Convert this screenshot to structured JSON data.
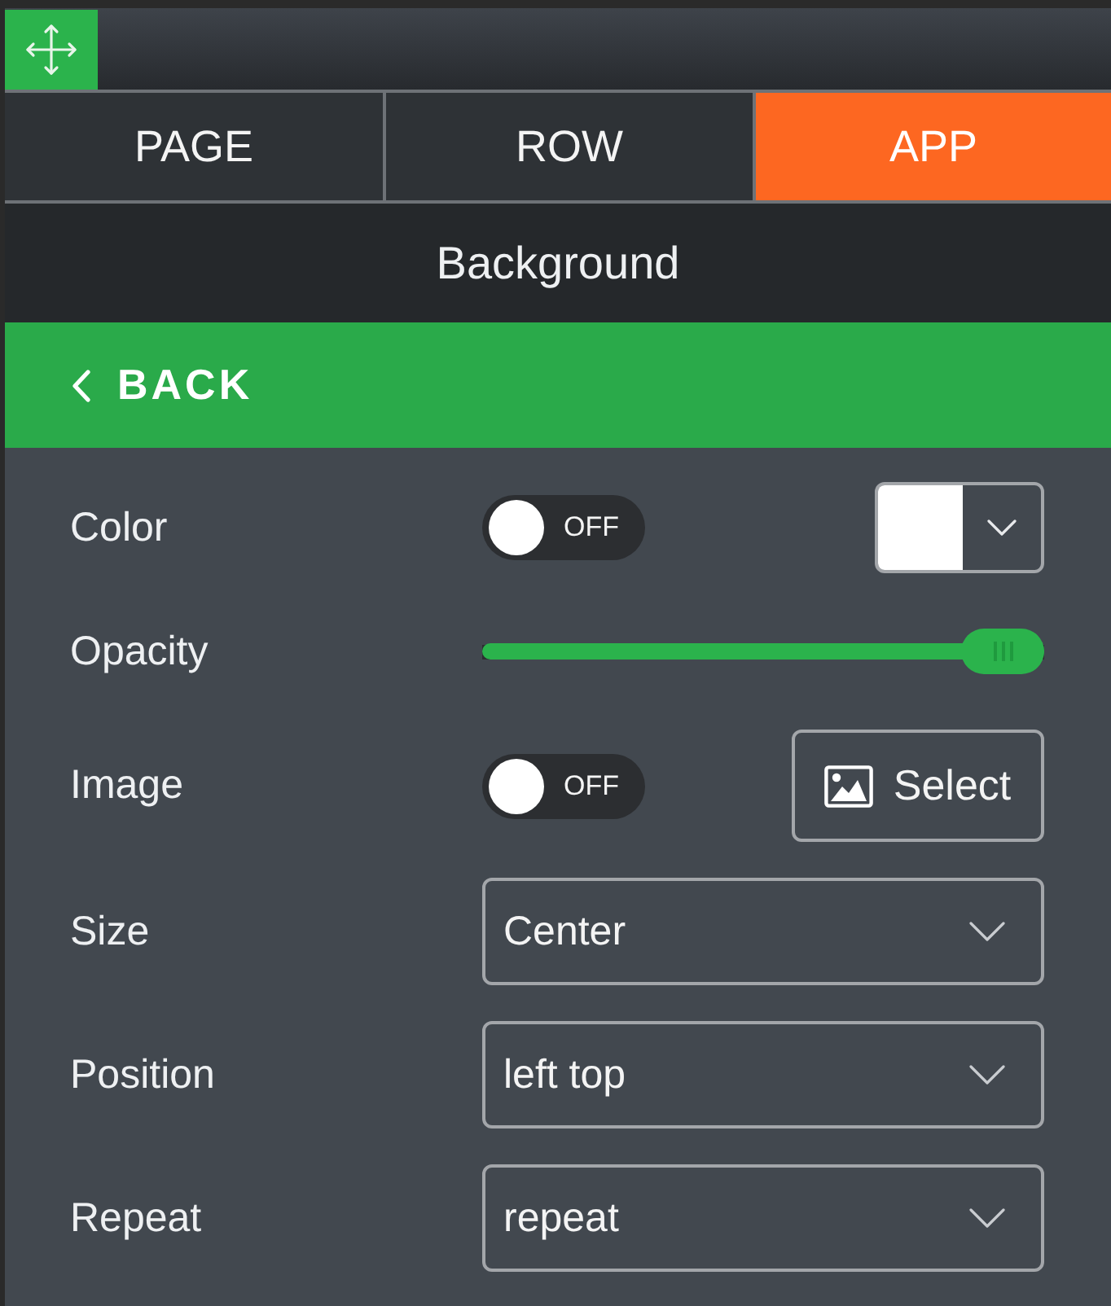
{
  "tabs": [
    {
      "label": "PAGE",
      "selected": false
    },
    {
      "label": "ROW",
      "selected": false
    },
    {
      "label": "APP",
      "selected": true
    }
  ],
  "section_title": "Background",
  "back_button": {
    "label": "BACK"
  },
  "settings": [
    {
      "kind": "toggle-swatch",
      "label": "Color",
      "toggle": {
        "on": false,
        "label": "OFF"
      },
      "color": "#ffffff"
    },
    {
      "kind": "slider",
      "label": "Opacity",
      "level": 1
    },
    {
      "kind": "toggle-button",
      "label": "Image",
      "toggle": {
        "on": false,
        "label": "OFF"
      },
      "button": "Select"
    },
    {
      "kind": "dropdown",
      "label": "Size",
      "value": "Center"
    },
    {
      "kind": "dropdown",
      "label": "Position",
      "value": "left top"
    },
    {
      "kind": "dropdown",
      "label": "Repeat",
      "value": "repeat"
    }
  ]
}
